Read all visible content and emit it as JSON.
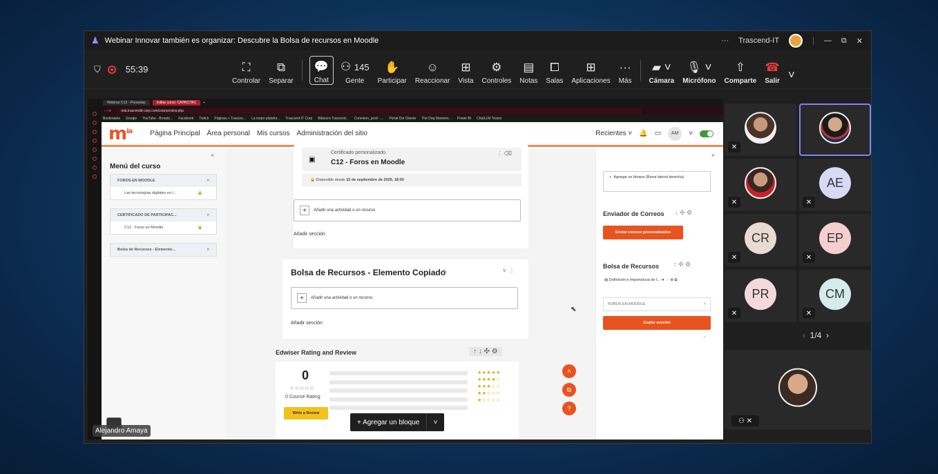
{
  "window": {
    "title": "Webinar Innovar también es organizar: Descubre la Bolsa de recursos en Moodle",
    "org": "Trascend-IT"
  },
  "toolbar": {
    "timer": "55:39",
    "buttons": [
      {
        "key": "controlar",
        "label": "Controlar",
        "icon": "screen-pointer-icon"
      },
      {
        "key": "separar",
        "label": "Separar",
        "icon": "popout-icon"
      },
      {
        "key": "chat",
        "label": "Chat",
        "icon": "chat-icon"
      },
      {
        "key": "gente",
        "label": "Gente",
        "icon": "people-icon",
        "count": "145"
      },
      {
        "key": "participar",
        "label": "Participar",
        "icon": "hand-icon"
      },
      {
        "key": "reaccionar",
        "label": "Reaccionar",
        "icon": "smile-icon"
      },
      {
        "key": "vista",
        "label": "Vista",
        "icon": "grid-icon"
      },
      {
        "key": "controles",
        "label": "Controles",
        "icon": "controls-icon"
      },
      {
        "key": "notas",
        "label": "Notas",
        "icon": "notes-icon"
      },
      {
        "key": "salas",
        "label": "Salas",
        "icon": "rooms-icon"
      },
      {
        "key": "aplicaciones",
        "label": "Aplicaciones",
        "icon": "plus-icon"
      },
      {
        "key": "mas",
        "label": "Más",
        "icon": "more-icon"
      },
      {
        "key": "camara",
        "label": "Cámara",
        "icon": "camera-off-icon"
      },
      {
        "key": "microfono",
        "label": "Micrófono",
        "icon": "mic-off-icon"
      },
      {
        "key": "comparte",
        "label": "Comparte",
        "icon": "share-icon"
      },
      {
        "key": "salir",
        "label": "Salir",
        "icon": "phone-icon"
      }
    ]
  },
  "browser": {
    "tabs": [
      "Webinar C13 - Presentac",
      "Editar curso: CAPACITAC"
    ],
    "url": "mia.trascendit-corp.com/course/view.php",
    "bookmarks": [
      "Bookmarks",
      "Google",
      "YouTube - Broadc...",
      "Facebook",
      "Twitch",
      "Páginas « Trascen...",
      "La mejor platafor...",
      "Trascend-IT Corp",
      "Bitácora Trascend...",
      "Conexion_prod - ...",
      "Portal Del Cliente",
      "The Dog Mansion...",
      "Power BI",
      "ChatLLM Teams"
    ]
  },
  "moodle": {
    "logo": "mia",
    "nav": [
      "Página Principal",
      "Área personal",
      "Mis cursos",
      "Administración del sitio"
    ],
    "recent": "Recientes",
    "avatar": "AM",
    "left": {
      "title": "Menú del curso",
      "sections": [
        {
          "h": "FOROS EN MOODLE",
          "rows": [
            "Las tecnologías digitales en l..."
          ]
        },
        {
          "h": "CERTIFICADO DE PARTICIPAC...",
          "rows": [
            "C12 - Foros en Moodle"
          ]
        },
        {
          "h": "Bolsa de Recursos - Elemento...",
          "rows": []
        }
      ]
    },
    "cert": {
      "label": "Certificado personalizado",
      "name": "C12 - Foros en Moodle",
      "avail_prefix": "Disponible desde ",
      "avail_date": "15 de septiembre de 2025, 18:00"
    },
    "add_activity": "Añadir una actividad o un recurso",
    "add_section": "Añadir sección",
    "bolsa": {
      "title": "Bolsa de Recursos - Elemento Copiado"
    },
    "rating": {
      "title": "Edwiser Rating and Review",
      "score": "0",
      "count": "0 Course Rating",
      "write": "Write a Review",
      "add_block": "+ Agregar un bloque"
    },
    "right": {
      "add_block": "Agregar un bloque (Barra lateral derecha)",
      "mail_title": "Enviador de Correos",
      "mail_btn": "Enviar correos personalizados",
      "bolsa_title": "Bolsa de Recursos",
      "bolsa_item": "Definición e Importancia de l...",
      "select": "FOROS EN MOODLE",
      "copy_btn": "Copiar sección"
    }
  },
  "presenter": "Alejandro Amaya",
  "participants": [
    {
      "i": ""
    },
    {
      "i": ""
    },
    {
      "i": ""
    },
    {
      "i": "AE",
      "c": "#d7d9f5"
    },
    {
      "i": "CR",
      "c": "#eadbd2"
    },
    {
      "i": "EP",
      "c": "#f5cfd0"
    },
    {
      "i": "PR",
      "c": "#f3d8dc"
    },
    {
      "i": "CM",
      "c": "#d6ecec"
    }
  ],
  "pager": "1/4"
}
